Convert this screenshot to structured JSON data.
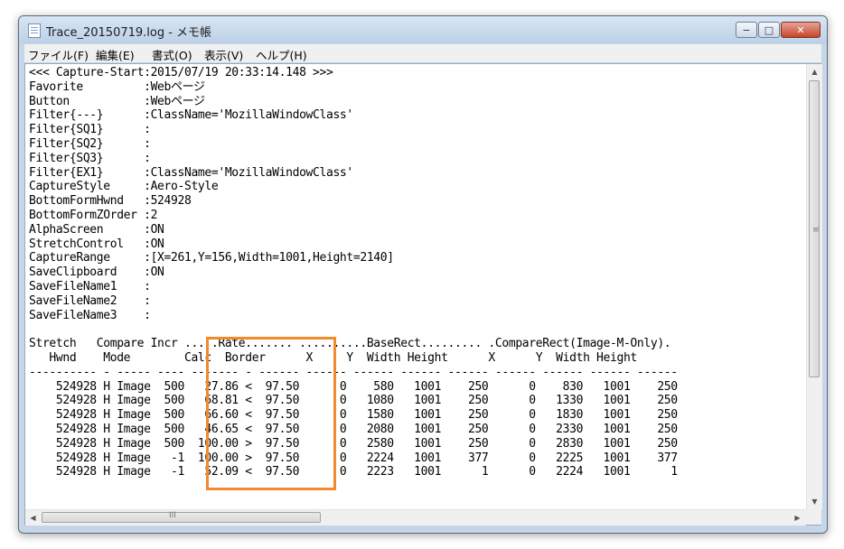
{
  "window": {
    "title": "Trace_20150719.log - メモ帳"
  },
  "controls": {
    "minimize": "−",
    "maximize": "□",
    "close": "✕"
  },
  "menu": [
    "ファイル(F)",
    "編集(E)",
    "書式(O)",
    "表示(V)",
    "ヘルプ(H)"
  ],
  "editor": {
    "text": "<<< Capture-Start:2015/07/19 20:33:14.148 >>>\nFavorite         :Webページ\nButton           :Webページ\nFilter{---}      :ClassName='MozillaWindowClass'\nFilter{SQ1}      :\nFilter{SQ2}      :\nFilter{SQ3}      :\nFilter{EX1}      :ClassName='MozillaWindowClass'\nCaptureStyle     :Aero-Style\nBottomFormHwnd   :524928\nBottomFormZOrder :2\nAlphaScreen      :ON\nStretchControl   :ON\nCaptureRange     :[X=261,Y=156,Width=1001,Height=2140]\nSaveClipboard    :ON\nSaveFileName1    :\nSaveFileName2    :\nSaveFileName3    :\n\nStretch   Compare Incr .....Rate....... ..........BaseRect......... .CompareRect(Image-M-Only).\n   Hwnd    Mode        Calc  Border      X     Y  Width Height      X      Y  Width Height\n---------- - ----- ---- ------- - ------ ------ ------ ------ ------ ------ ------ ------ ------\n    524928 H Image  500   27.86 <  97.50      0    580   1001    250      0    830   1001    250\n    524928 H Image  500   68.81 <  97.50      0   1080   1001    250      0   1330   1001    250\n    524928 H Image  500   66.60 <  97.50      0   1580   1001    250      0   1830   1001    250\n    524928 H Image  500   46.65 <  97.50      0   2080   1001    250      0   2330   1001    250\n    524928 H Image  500  100.00 >  97.50      0   2580   1001    250      0   2830   1001    250\n    524928 H Image   -1  100.00 >  97.50      0   2224   1001    377      0   2225   1001    377\n    524928 H Image   -1   52.09 <  97.50      0   2223   1001      1      0   2224   1001      1"
  },
  "scrollbars": {
    "up": "▲",
    "down": "▼",
    "left": "◀",
    "right": "▶",
    "v_grip": "≡",
    "h_grip": "III"
  }
}
